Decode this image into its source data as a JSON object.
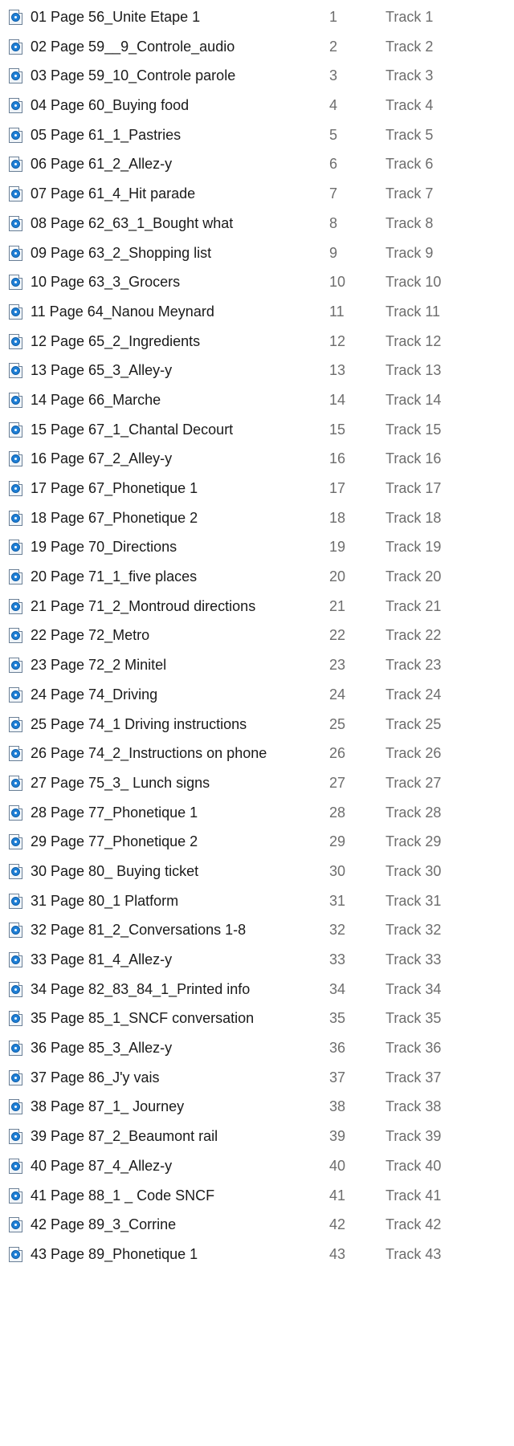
{
  "files": [
    {
      "name": "01 Page 56_Unite Etape 1",
      "number": "1",
      "title": "Track 1"
    },
    {
      "name": "02 Page 59__9_Controle_audio",
      "number": "2",
      "title": "Track 2"
    },
    {
      "name": "03 Page 59_10_Controle parole",
      "number": "3",
      "title": "Track 3"
    },
    {
      "name": "04 Page 60_Buying food",
      "number": "4",
      "title": "Track 4"
    },
    {
      "name": "05 Page 61_1_Pastries",
      "number": "5",
      "title": "Track 5"
    },
    {
      "name": "06 Page 61_2_Allez-y",
      "number": "6",
      "title": "Track 6"
    },
    {
      "name": "07 Page 61_4_Hit parade",
      "number": "7",
      "title": "Track 7"
    },
    {
      "name": "08 Page 62_63_1_Bought what",
      "number": "8",
      "title": "Track 8"
    },
    {
      "name": "09 Page 63_2_Shopping list",
      "number": "9",
      "title": "Track 9"
    },
    {
      "name": "10 Page 63_3_Grocers",
      "number": "10",
      "title": "Track 10"
    },
    {
      "name": "11 Page 64_Nanou Meynard",
      "number": "11",
      "title": "Track 11"
    },
    {
      "name": "12 Page 65_2_Ingredients",
      "number": "12",
      "title": "Track 12"
    },
    {
      "name": "13 Page 65_3_Alley-y",
      "number": "13",
      "title": "Track 13"
    },
    {
      "name": "14 Page 66_Marche",
      "number": "14",
      "title": "Track 14"
    },
    {
      "name": "15 Page 67_1_Chantal Decourt",
      "number": "15",
      "title": "Track 15"
    },
    {
      "name": "16 Page 67_2_Alley-y",
      "number": "16",
      "title": "Track 16"
    },
    {
      "name": "17 Page 67_Phonetique 1",
      "number": "17",
      "title": "Track 17"
    },
    {
      "name": "18 Page 67_Phonetique 2",
      "number": "18",
      "title": "Track 18"
    },
    {
      "name": "19 Page 70_Directions",
      "number": "19",
      "title": "Track 19"
    },
    {
      "name": "20 Page 71_1_five places",
      "number": "20",
      "title": "Track 20"
    },
    {
      "name": "21 Page 71_2_Montroud directions",
      "number": "21",
      "title": "Track 21"
    },
    {
      "name": "22 Page 72_Metro",
      "number": "22",
      "title": "Track 22"
    },
    {
      "name": "23 Page 72_2 Minitel",
      "number": "23",
      "title": "Track 23"
    },
    {
      "name": "24 Page 74_Driving",
      "number": "24",
      "title": "Track 24"
    },
    {
      "name": "25 Page 74_1 Driving instructions",
      "number": "25",
      "title": "Track 25"
    },
    {
      "name": "26 Page 74_2_Instructions on phone",
      "number": "26",
      "title": "Track 26"
    },
    {
      "name": "27 Page 75_3_ Lunch signs",
      "number": "27",
      "title": "Track 27"
    },
    {
      "name": "28 Page 77_Phonetique 1",
      "number": "28",
      "title": "Track 28"
    },
    {
      "name": "29 Page 77_Phonetique 2",
      "number": "29",
      "title": "Track 29"
    },
    {
      "name": "30 Page 80_ Buying ticket",
      "number": "30",
      "title": "Track 30"
    },
    {
      "name": "31 Page 80_1 Platform",
      "number": "31",
      "title": "Track 31"
    },
    {
      "name": "32 Page 81_2_Conversations 1-8",
      "number": "32",
      "title": "Track 32"
    },
    {
      "name": "33 Page 81_4_Allez-y",
      "number": "33",
      "title": "Track 33"
    },
    {
      "name": "34 Page 82_83_84_1_Printed info",
      "number": "34",
      "title": "Track 34"
    },
    {
      "name": "35 Page 85_1_SNCF conversation",
      "number": "35",
      "title": "Track 35"
    },
    {
      "name": "36 Page 85_3_Allez-y",
      "number": "36",
      "title": "Track 36"
    },
    {
      "name": "37 Page 86_J'y vais",
      "number": "37",
      "title": "Track 37"
    },
    {
      "name": "38 Page 87_1_ Journey",
      "number": "38",
      "title": "Track 38"
    },
    {
      "name": "39 Page 87_2_Beaumont rail",
      "number": "39",
      "title": "Track 39"
    },
    {
      "name": "40 Page 87_4_Allez-y",
      "number": "40",
      "title": "Track 40"
    },
    {
      "name": "41 Page 88_1 _ Code SNCF",
      "number": "41",
      "title": "Track 41"
    },
    {
      "name": "42 Page 89_3_Corrine",
      "number": "42",
      "title": "Track 42"
    },
    {
      "name": "43 Page 89_Phonetique 1",
      "number": "43",
      "title": "Track 43"
    }
  ],
  "file_icon": "audio-file-icon",
  "colors": {
    "name_text": "#1a1a1a",
    "meta_text": "#6d6d6d",
    "icon_accent": "#1e7fd6"
  }
}
